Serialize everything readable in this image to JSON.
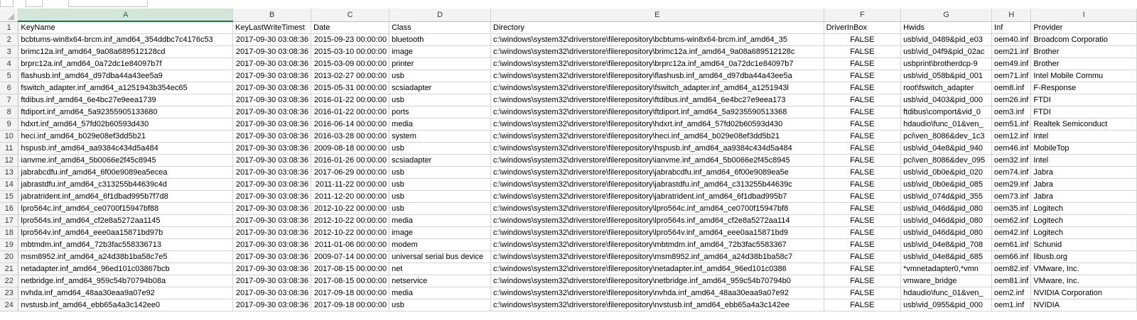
{
  "columns": [
    "A",
    "B",
    "C",
    "D",
    "E",
    "F",
    "G",
    "H",
    "I"
  ],
  "selected_column": "A",
  "headers": [
    "KeyName",
    "KeyLastWriteTimest",
    "Date",
    "Class",
    "Directory",
    "DriverInBox",
    "Hwids",
    "Inf",
    "Provider"
  ],
  "rows": [
    [
      "bcbtums-win8x64-brcm.inf_amd64_354ddbc7c4176c53",
      "2017-09-30 03:08:36",
      "2015-09-23 00:00:00",
      "bluetooth",
      "c:\\windows\\system32\\driverstore\\filerepository\\bcbtums-win8x64-brcm.inf_amd64_35",
      "FALSE",
      "usb\\vid_0489&pid_e03",
      "oem40.inf",
      "Broadcom Corporatio"
    ],
    [
      "brimc12a.inf_amd64_9a08a689512128cd",
      "2017-09-30 03:08:36",
      "2015-03-10 00:00:00",
      "image",
      "c:\\windows\\system32\\driverstore\\filerepository\\brimc12a.inf_amd64_9a08a689512128c",
      "FALSE",
      "usb\\vid_04f9&pid_02ac",
      "oem21.inf",
      "Brother"
    ],
    [
      "brprc12a.inf_amd64_0a72dc1e84097b7f",
      "2017-09-30 03:08:36",
      "2015-03-09 00:00:00",
      "printer",
      "c:\\windows\\system32\\driverstore\\filerepository\\brprc12a.inf_amd64_0a72dc1e84097b7",
      "FALSE",
      "usbprint\\brotherdcp-9",
      "oem49.inf",
      "Brother"
    ],
    [
      "flashusb.inf_amd64_d97dba44a43ee5a9",
      "2017-09-30 03:08:36",
      "2013-02-27 00:00:00",
      "usb",
      "c:\\windows\\system32\\driverstore\\filerepository\\flashusb.inf_amd64_d97dba44a43ee5a",
      "FALSE",
      "usb\\vid_058b&pid_001",
      "oem71.inf",
      "Intel Mobile Commu"
    ],
    [
      "fswitch_adapter.inf_amd64_a1251943b354ec65",
      "2017-09-30 03:08:36",
      "2015-05-31 00:00:00",
      "scsiadapter",
      "c:\\windows\\system32\\driverstore\\filerepository\\fswitch_adapter.inf_amd64_a1251943l",
      "FALSE",
      "root\\fswitch_adapter",
      "oem8.inf",
      "F-Response"
    ],
    [
      "ftdibus.inf_amd64_6e4bc27e9eea1739",
      "2017-09-30 03:08:36",
      "2016-01-22 00:00:00",
      "usb",
      "c:\\windows\\system32\\driverstore\\filerepository\\ftdibus.inf_amd64_6e4bc27e9eea173",
      "FALSE",
      "usb\\vid_0403&pid_000",
      "oem26.inf",
      "FTDI"
    ],
    [
      "ftdiport.inf_amd64_5a92355905133680",
      "2017-09-30 03:08:36",
      "2016-01-22 00:00:00",
      "ports",
      "c:\\windows\\system32\\driverstore\\filerepository\\ftdiport.inf_amd64_5a9235590513368",
      "FALSE",
      "ftdibus\\comport&vid_0",
      "oem3.inf",
      "FTDI"
    ],
    [
      "hdxrt.inf_amd64_57fd02b60593d430",
      "2017-09-30 03:08:36",
      "2016-06-14 00:00:00",
      "media",
      "c:\\windows\\system32\\driverstore\\filerepository\\hdxrt.inf_amd64_57fd02b60593d430",
      "FALSE",
      "hdaudio\\func_01&ven_",
      "oem51.inf",
      "Realtek Semiconduct"
    ],
    [
      "heci.inf_amd64_b029e08ef3dd5b21",
      "2017-09-30 03:08:36",
      "2016-03-28 00:00:00",
      "system",
      "c:\\windows\\system32\\driverstore\\filerepository\\heci.inf_amd64_b029e08ef3dd5b21",
      "FALSE",
      "pci\\ven_8086&dev_1c3",
      "oem12.inf",
      "Intel"
    ],
    [
      "hspusb.inf_amd64_aa9384c434d5a484",
      "2017-09-30 03:08:36",
      "2009-08-18 00:00:00",
      "usb",
      "c:\\windows\\system32\\driverstore\\filerepository\\hspusb.inf_amd64_aa9384c434d5a484",
      "FALSE",
      "usb\\vid_04e8&pid_940",
      "oem46.inf",
      "MobileTop"
    ],
    [
      "ianvme.inf_amd64_5b0066e2f45c8945",
      "2017-09-30 03:08:36",
      "2016-01-26 00:00:00",
      "scsiadapter",
      "c:\\windows\\system32\\driverstore\\filerepository\\ianvme.inf_amd64_5b0066e2f45c8945",
      "FALSE",
      "pci\\ven_8086&dev_095",
      "oem32.inf",
      "Intel"
    ],
    [
      "jabrabcdfu.inf_amd64_6f00e9089ea5ecea",
      "2017-09-30 03:08:36",
      "2017-06-29 00:00:00",
      "usb",
      "c:\\windows\\system32\\driverstore\\filerepository\\jabrabcdfu.inf_amd64_6f00e9089ea5e",
      "FALSE",
      "usb\\vid_0b0e&pid_020",
      "oem74.inf",
      "Jabra"
    ],
    [
      "jabrastdfu.inf_amd64_c313255b44639c4d",
      "2017-09-30 03:08:36",
      "2011-11-22 00:00:00",
      "usb",
      "c:\\windows\\system32\\driverstore\\filerepository\\jabrastdfu.inf_amd64_c313255b44639c",
      "FALSE",
      "usb\\vid_0b0e&pid_085",
      "oem29.inf",
      "Jabra"
    ],
    [
      "jabratrident.inf_amd64_6f1dbad995b7f7d8",
      "2017-09-30 03:08:36",
      "2011-12-20 00:00:00",
      "usb",
      "c:\\windows\\system32\\driverstore\\filerepository\\jabratrident.inf_amd64_6f1dbad995b7",
      "FALSE",
      "usb\\vid_074d&pid_355",
      "oem73.inf",
      "Jabra"
    ],
    [
      "lpro564c.inf_amd64_ce0700f15947bf88",
      "2017-09-30 03:08:36",
      "2012-10-22 00:00:00",
      "usb",
      "c:\\windows\\system32\\driverstore\\filerepository\\lpro564c.inf_amd64_ce0700f15947bf8",
      "FALSE",
      "usb\\vid_046d&pid_080",
      "oem35.inf",
      "Logitech"
    ],
    [
      "lpro564s.inf_amd64_cf2e8a5272aa1145",
      "2017-09-30 03:08:36",
      "2012-10-22 00:00:00",
      "media",
      "c:\\windows\\system32\\driverstore\\filerepository\\lpro564s.inf_amd64_cf2e8a5272aa114",
      "FALSE",
      "usb\\vid_046d&pid_080",
      "oem62.inf",
      "Logitech"
    ],
    [
      "lpro564v.inf_amd64_eee0aa15871bd97b",
      "2017-09-30 03:08:36",
      "2012-10-22 00:00:00",
      "image",
      "c:\\windows\\system32\\driverstore\\filerepository\\lpro564v.inf_amd64_eee0aa15871bd9",
      "FALSE",
      "usb\\vid_046d&pid_080",
      "oem42.inf",
      "Logitech"
    ],
    [
      "mbtmdm.inf_amd64_72b3fac558336713",
      "2017-09-30 03:08:36",
      "2011-01-06 00:00:00",
      "modem",
      "c:\\windows\\system32\\driverstore\\filerepository\\mbtmdm.inf_amd64_72b3fac5583367",
      "FALSE",
      "usb\\vid_04e8&pid_708",
      "oem61.inf",
      "Schunid"
    ],
    [
      "msm8952.inf_amd64_a24d38b1ba58c7e5",
      "2017-09-30 03:08:36",
      "2009-07-14 00:00:00",
      "universal serial bus device",
      "c:\\windows\\system32\\driverstore\\filerepository\\msm8952.inf_amd64_a24d38b1ba58c7",
      "FALSE",
      "usb\\vid_04e8&pid_685",
      "oem66.inf",
      "libusb.org"
    ],
    [
      "netadapter.inf_amd64_96ed101c03867bcb",
      "2017-09-30 03:08:36",
      "2017-08-15 00:00:00",
      "net",
      "c:\\windows\\system32\\driverstore\\filerepository\\netadapter.inf_amd64_96ed101c0386",
      "FALSE",
      "*vmnetadapter0,*vmn",
      "oem82.inf",
      "VMware, Inc."
    ],
    [
      "netbridge.inf_amd64_959c54b70794b08a",
      "2017-09-30 03:08:36",
      "2017-08-15 00:00:00",
      "netservice",
      "c:\\windows\\system32\\driverstore\\filerepository\\netbridge.inf_amd64_959c54b70794b0",
      "FALSE",
      "vmware_bridge",
      "oem81.inf",
      "VMware, Inc."
    ],
    [
      "nvhda.inf_amd64_48aa30eaa9a07e92",
      "2017-09-30 03:08:36",
      "2017-09-18 00:00:00",
      "media",
      "c:\\windows\\system32\\driverstore\\filerepository\\nvhda.inf_amd64_48aa30eaa9a07e92",
      "FALSE",
      "hdaudio\\func_01&ven_",
      "oem2.inf",
      "NVIDIA Corporation"
    ],
    [
      "nvstusb.inf_amd64_ebb65a4a3c142ee0",
      "2017-09-30 03:08:36",
      "2017-09-18 00:00:00",
      "usb",
      "c:\\windows\\system32\\driverstore\\filerepository\\nvstusb.inf_amd64_ebb65a4a3c142ee",
      "FALSE",
      "usb\\vid_0955&pid_000",
      "oem1.inf",
      "NVIDIA"
    ]
  ]
}
